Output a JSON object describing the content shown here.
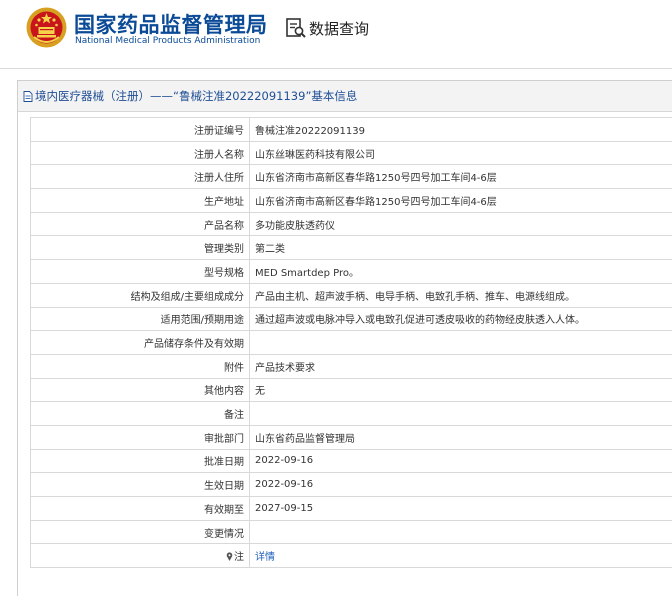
{
  "header": {
    "org_name": "国家药品监督管理局",
    "org_name_en": "National Medical Products Administration",
    "query_label": "数据查询",
    "brand_color": "#0a4a96",
    "emblem_icon": "national-emblem"
  },
  "panel": {
    "title": "境内医疗器械（注册）——“鲁械注准20222091139”基本信息",
    "title_icon": "document-icon"
  },
  "rows": [
    {
      "label": "注册证编号",
      "value": "鲁械注准20222091139"
    },
    {
      "label": "注册人名称",
      "value": "山东丝琳医药科技有限公司"
    },
    {
      "label": "注册人住所",
      "value": "山东省济南市高新区春华路1250号四号加工车间4-6层"
    },
    {
      "label": "生产地址",
      "value": "山东省济南市高新区春华路1250号四号加工车间4-6层"
    },
    {
      "label": "产品名称",
      "value": "多功能皮肤透药仪"
    },
    {
      "label": "管理类别",
      "value": "第二类"
    },
    {
      "label": "型号规格",
      "value": "MED Smartdep Pro。"
    },
    {
      "label": "结构及组成/主要组成成分",
      "value": "产品由主机、超声波手柄、电导手柄、电致孔手柄、推车、电源线组成。"
    },
    {
      "label": "适用范围/预期用途",
      "value": "通过超声波或电脉冲导入或电致孔促进可透皮吸收的药物经皮肤透入人体。"
    },
    {
      "label": "产品储存条件及有效期",
      "value": ""
    },
    {
      "label": "附件",
      "value": "产品技术要求"
    },
    {
      "label": "其他内容",
      "value": "无"
    },
    {
      "label": "备注",
      "value": ""
    },
    {
      "label": "审批部门",
      "value": "山东省药品监督管理局"
    },
    {
      "label": "批准日期",
      "value": "2022-09-16"
    },
    {
      "label": "生效日期",
      "value": "2022-09-16"
    },
    {
      "label": "有效期至",
      "value": "2027-09-15"
    },
    {
      "label": "变更情况",
      "value": ""
    }
  ],
  "note_row": {
    "label": "注",
    "link_text": "详情",
    "icon": "pin-icon"
  }
}
